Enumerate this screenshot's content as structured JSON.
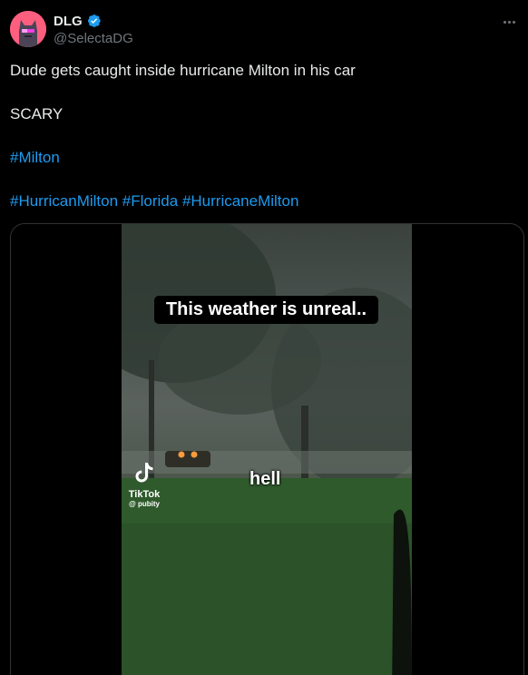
{
  "author": {
    "display_name": "DLG",
    "handle": "@SelectaDG",
    "avatar_icon": "cat-avatar-icon",
    "verified_icon": "verified-badge-icon",
    "verified_color": "#1d9bf0"
  },
  "menu": {
    "more_icon": "more-options-icon"
  },
  "tweet": {
    "line1": "Dude gets caught inside hurricane Milton in his car",
    "line2": "SCARY",
    "hashtag1": "#Milton",
    "hashtag2": "#HurricanMilton",
    "hashtag3": "#Florida",
    "hashtag4": "#HurricaneMilton",
    "link_color": "#1d9bf0"
  },
  "video": {
    "caption": "This weather is unreal..",
    "subtitle": "hell",
    "watermark_brand": "TikTok",
    "watermark_user": "@ pubity"
  }
}
